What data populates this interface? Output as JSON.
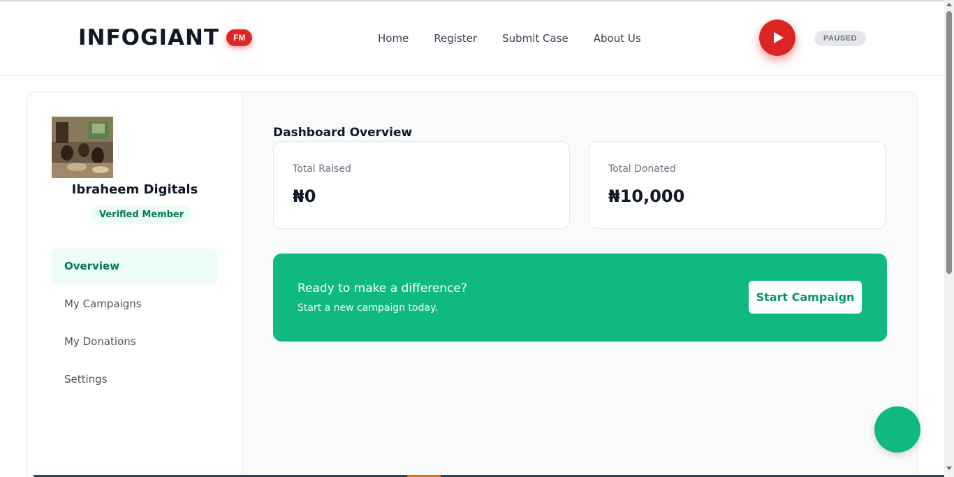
{
  "header": {
    "logo_text": "INFOGIANT",
    "logo_badge": "FM",
    "nav": [
      "Home",
      "Register",
      "Submit Case",
      "About Us"
    ],
    "player_status": "PAUSED"
  },
  "profile": {
    "name": "Ibraheem Digitals",
    "badge": "Verified Member"
  },
  "sidebar": {
    "items": [
      {
        "label": "Overview",
        "active": true
      },
      {
        "label": "My Campaigns",
        "active": false
      },
      {
        "label": "My Donations",
        "active": false
      },
      {
        "label": "Settings",
        "active": false
      }
    ]
  },
  "dashboard": {
    "title": "Dashboard Overview",
    "stats": [
      {
        "label": "Total Raised",
        "value": "₦0"
      },
      {
        "label": "Total Donated",
        "value": "₦10,000"
      }
    ],
    "cta": {
      "title": "Ready to make a difference?",
      "subtitle": "Start a new campaign today.",
      "button": "Start Campaign"
    }
  },
  "colors": {
    "brand_red": "#dc2626",
    "brand_green": "#10b981",
    "dark_text": "#111827"
  },
  "icons": {
    "player": "play-icon"
  }
}
